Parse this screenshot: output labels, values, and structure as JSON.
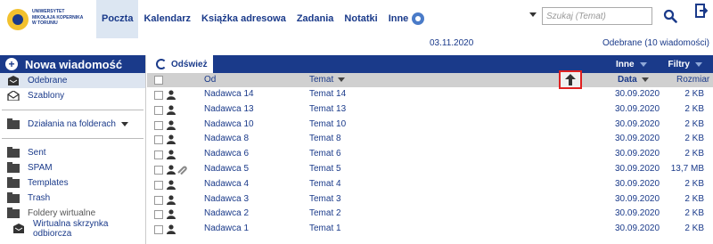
{
  "logo": {
    "lines": [
      "UNIWERSYTET",
      "MIKOŁAJA KOPERNIKA",
      "W TORUNIU"
    ]
  },
  "nav": {
    "items": [
      {
        "label": "Poczta",
        "active": true
      },
      {
        "label": "Kalendarz",
        "active": false
      },
      {
        "label": "Książka adresowa",
        "active": false
      },
      {
        "label": "Zadania",
        "active": false
      },
      {
        "label": "Notatki",
        "active": false
      },
      {
        "label": "Inne",
        "active": false
      }
    ],
    "settings_icon": "gear-icon"
  },
  "search": {
    "placeholder": "Szukaj (Temat)",
    "value": "",
    "search_icon": "search-icon",
    "logout_icon": "logout-icon"
  },
  "status": {
    "date": "03.11.2020",
    "folder_info": "Odebrane (10 wiadomości)"
  },
  "sidebar": {
    "new_message_label": "Nowa wiadomość",
    "top_items": [
      {
        "label": "Odebrane",
        "icon": "inbox-icon",
        "active": true
      },
      {
        "label": "Szablony",
        "icon": "template-icon",
        "active": false
      }
    ],
    "folder_actions_label": "Działania na folderach",
    "folders": [
      {
        "label": "Sent",
        "icon": "folder-icon"
      },
      {
        "label": "SPAM",
        "icon": "folder-icon"
      },
      {
        "label": "Templates",
        "icon": "folder-icon"
      },
      {
        "label": "Trash",
        "icon": "folder-icon"
      },
      {
        "label": "Foldery wirtualne",
        "icon": "virtual-folder-icon"
      },
      {
        "label": "Wirtualna skrzynka odbiorcza",
        "icon": "virtual-inbox-icon"
      }
    ]
  },
  "toolbar": {
    "refresh_label": "Odśwież",
    "other_label": "Inne",
    "filters_label": "Filtry"
  },
  "table": {
    "columns": {
      "from": "Od",
      "subject": "Temat",
      "date": "Data",
      "size": "Rozmiar"
    },
    "rows": [
      {
        "from": "Nadawca 14",
        "subject": "Temat 14",
        "date": "30.09.2020",
        "size": "2 KB",
        "attachment": false
      },
      {
        "from": "Nadawca 13",
        "subject": "Temat 13",
        "date": "30.09.2020",
        "size": "2 KB",
        "attachment": false
      },
      {
        "from": "Nadawca 10",
        "subject": "Temat 10",
        "date": "30.09.2020",
        "size": "2 KB",
        "attachment": false
      },
      {
        "from": "Nadawca 8",
        "subject": "Temat 8",
        "date": "30.09.2020",
        "size": "2 KB",
        "attachment": false
      },
      {
        "from": "Nadawca 6",
        "subject": "Temat 6",
        "date": "30.09.2020",
        "size": "2 KB",
        "attachment": false
      },
      {
        "from": "Nadawca 5",
        "subject": "Temat 5",
        "date": "30.09.2020",
        "size": "13,7 MB",
        "attachment": true
      },
      {
        "from": "Nadawca 4",
        "subject": "Temat 4",
        "date": "30.09.2020",
        "size": "2 KB",
        "attachment": false
      },
      {
        "from": "Nadawca 3",
        "subject": "Temat 3",
        "date": "30.09.2020",
        "size": "2 KB",
        "attachment": false
      },
      {
        "from": "Nadawca 2",
        "subject": "Temat 2",
        "date": "30.09.2020",
        "size": "2 KB",
        "attachment": false
      },
      {
        "from": "Nadawca 1",
        "subject": "Temat 1",
        "date": "30.09.2020",
        "size": "2 KB",
        "attachment": false
      }
    ]
  },
  "colors": {
    "brand": "#1a3a8a",
    "highlight": "#e02020"
  }
}
